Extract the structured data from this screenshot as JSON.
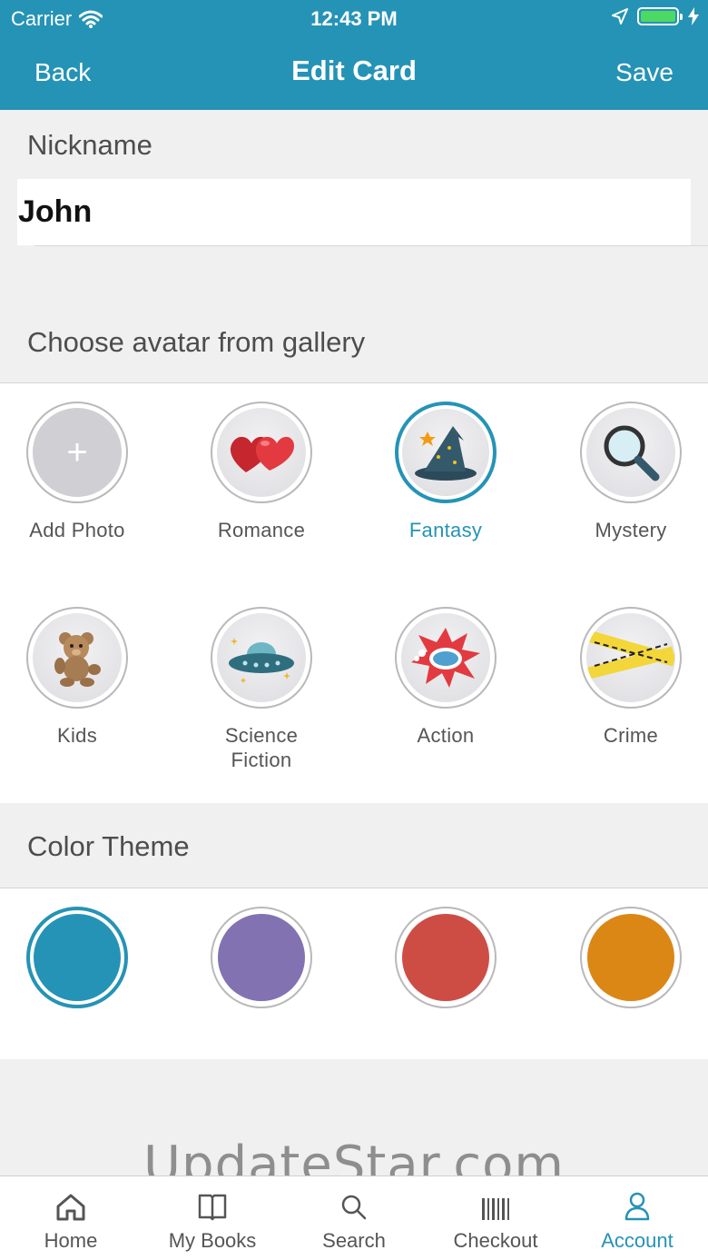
{
  "status_bar": {
    "carrier": "Carrier",
    "time": "12:43 PM"
  },
  "nav": {
    "back_label": "Back",
    "title": "Edit Card",
    "save_label": "Save"
  },
  "nickname": {
    "section_label": "Nickname",
    "value": "John"
  },
  "avatar_gallery": {
    "section_label": "Choose avatar from gallery",
    "items": [
      {
        "label": "Add Photo",
        "icon": "plus-icon"
      },
      {
        "label": "Romance",
        "icon": "hearts-icon"
      },
      {
        "label": "Fantasy",
        "icon": "wizard-hat-icon",
        "selected": true
      },
      {
        "label": "Mystery",
        "icon": "magnifier-icon"
      },
      {
        "label": "Kids",
        "icon": "teddy-bear-icon"
      },
      {
        "label": "Science Fiction",
        "label_line1": "Science",
        "label_line2": "Fiction",
        "icon": "ufo-icon"
      },
      {
        "label": "Action",
        "icon": "boom-icon"
      },
      {
        "label": "Crime",
        "icon": "crime-tape-icon"
      }
    ]
  },
  "color_theme": {
    "section_label": "Color Theme",
    "colors": [
      "#2593b6",
      "#8372b2",
      "#cd4d45",
      "#db8716"
    ],
    "selected_index": 0
  },
  "watermark": "UpdateStar.com",
  "tabbar": {
    "tabs": [
      {
        "label": "Home",
        "icon": "home-icon"
      },
      {
        "label": "My Books",
        "icon": "book-icon"
      },
      {
        "label": "Search",
        "icon": "search-icon"
      },
      {
        "label": "Checkout",
        "icon": "barcode-icon"
      },
      {
        "label": "Account",
        "icon": "person-icon",
        "active": true
      }
    ]
  },
  "accent_color": "#2593b6"
}
